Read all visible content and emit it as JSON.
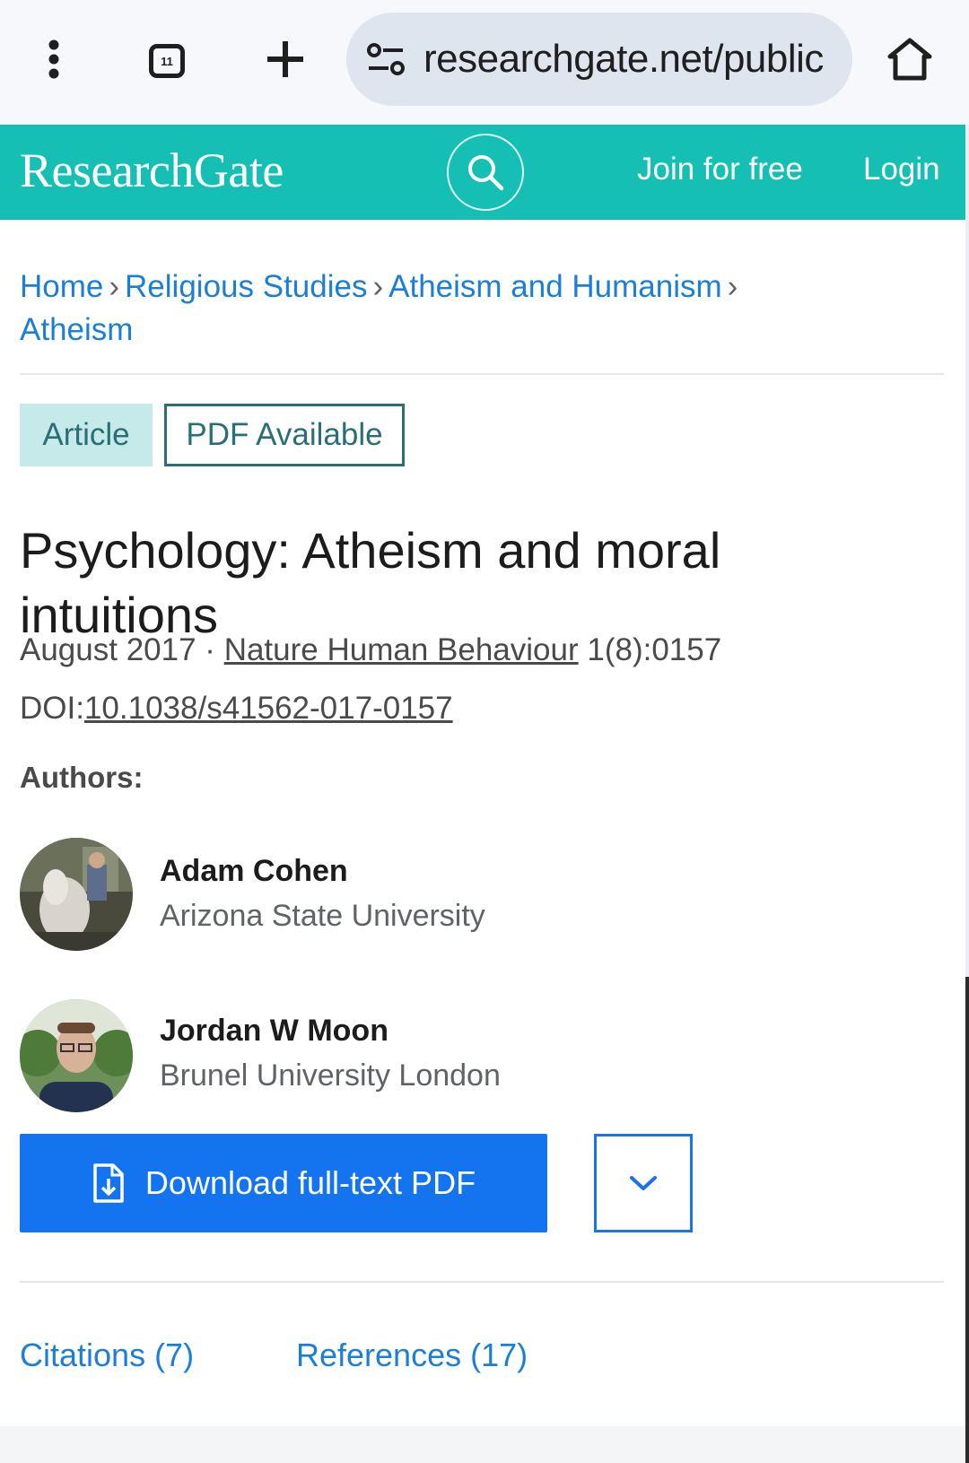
{
  "browser": {
    "url": "researchgate.net/public",
    "tabs_count": "11",
    "icons": [
      "menu-dots-icon",
      "tabs-icon",
      "plus-icon",
      "tune-icon",
      "home-icon"
    ]
  },
  "header": {
    "logo": "ResearchGate",
    "join_label": "Join for free",
    "login_label": "Login",
    "colors": {
      "brand": "#16bfb4"
    }
  },
  "breadcrumb": {
    "items": [
      "Home",
      "Religious Studies",
      "Atheism and Humanism",
      "Atheism"
    ]
  },
  "badges": {
    "type": "Article",
    "pdf": "PDF Available"
  },
  "article": {
    "title": "Psychology: Atheism and moral intuitions",
    "date": "August 2017",
    "separator": "·",
    "journal": "Nature Human Behaviour",
    "volume": "1(8):0157",
    "doi_label": "DOI:",
    "doi": "10.1038/s41562-017-0157"
  },
  "authors": {
    "label": "Authors:",
    "list": [
      {
        "name": "Adam Cohen",
        "affiliation": "Arizona State University"
      },
      {
        "name": "Jordan W Moon",
        "affiliation": "Brunel University London"
      }
    ]
  },
  "actions": {
    "download_label": "Download full-text PDF",
    "colors": {
      "primary": "#1474f0"
    }
  },
  "tabs": {
    "citations": "Citations (7)",
    "references": "References (17)"
  }
}
